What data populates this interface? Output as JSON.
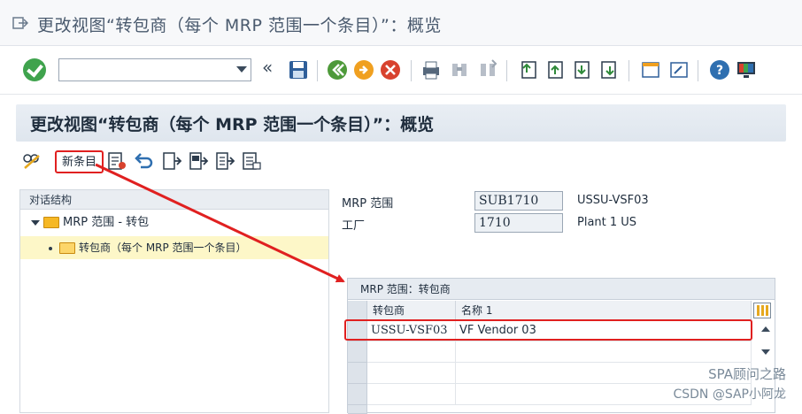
{
  "window": {
    "title": "更改视图“转包商（每个 MRP 范围一个条目）”：概览"
  },
  "screen_header": {
    "title": "更改视图“转包商（每个 MRP 范围一个条目）”：概览"
  },
  "app_toolbar": {
    "new_entries_label": "新条目"
  },
  "tree": {
    "header": "对话结构",
    "node1": "MRP 范围 - 转包",
    "node2": "转包商（每个 MRP 范围一个条目）"
  },
  "fields": {
    "mrp_area_label": "MRP 范围",
    "mrp_area_value": "SUB1710",
    "mrp_area_desc": "USSU-VSF03",
    "plant_label": "工厂",
    "plant_value": "1710",
    "plant_desc": "Plant 1 US"
  },
  "table": {
    "title": "MRP 范围：转包商",
    "columns": [
      "转包商",
      "名称 1"
    ],
    "rows": [
      {
        "vendor": "USSU-VSF03",
        "name": "VF Vendor 03"
      }
    ]
  },
  "watermark": {
    "line1": "SPA顾问之路",
    "line2": "CSDN @SAP小阿龙"
  },
  "colors": {
    "highlight": "#e02020",
    "accent": "#3fa34d"
  }
}
